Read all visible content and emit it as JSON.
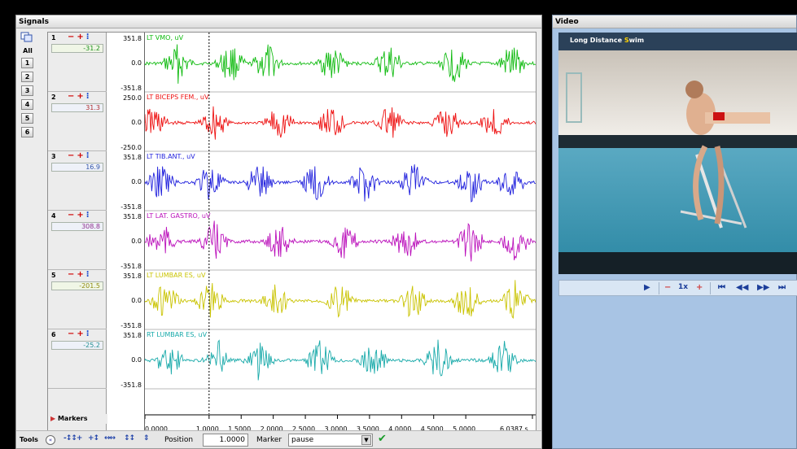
{
  "signals": {
    "title": "Signals",
    "selector_all": "All",
    "channel_buttons": [
      "1",
      "2",
      "3",
      "4",
      "5",
      "6"
    ],
    "channels": [
      {
        "num": "1",
        "value": "-31.2",
        "name": "LT VMO, uV",
        "max": "351.8",
        "zero": "0.0",
        "min": "-351.8",
        "color": "#11bb11",
        "value_color": "#1b8f1b"
      },
      {
        "num": "2",
        "value": "31.3",
        "name": "LT BICEPS FEM., uV",
        "max": "250.0",
        "zero": "0.0",
        "min": "-250.0",
        "color": "#ee1111",
        "value_color": "#b03030"
      },
      {
        "num": "3",
        "value": "16.9",
        "name": "LT TIB.ANT., uV",
        "max": "351.8",
        "zero": "0.0",
        "min": "-351.8",
        "color": "#2222dd",
        "value_color": "#3355aa"
      },
      {
        "num": "4",
        "value": "308.8",
        "name": "LT LAT. GASTRO, uV",
        "max": "351.8",
        "zero": "0.0",
        "min": "-351.8",
        "color": "#bb11bb",
        "value_color": "#903090"
      },
      {
        "num": "5",
        "value": "-201.5",
        "name": "LT LUMBAR ES, uV",
        "max": "351.8",
        "zero": "0.0",
        "min": "-351.8",
        "color": "#c9c300",
        "value_color": "#8f8a10"
      },
      {
        "num": "6",
        "value": "-25.2",
        "name": "RT LUMBAR ES, uV",
        "max": "351.8",
        "zero": "0.0",
        "min": "-351.8",
        "color": "#19aaaa",
        "value_color": "#208f8f"
      }
    ],
    "markers_label": "Markers",
    "time_ticks": [
      "0.0000",
      "1.0000",
      "1.5000",
      "2.0000",
      "2.5000",
      "3.0000",
      "3.5000",
      "4.0000",
      "4.5000",
      "5.0000",
      "6.0387 s"
    ],
    "time_values": [
      0,
      1.0,
      1.5,
      2.0,
      2.5,
      3.0,
      3.5,
      4.0,
      4.5,
      5.0,
      6.0387
    ],
    "time_range": [
      0,
      6.0387
    ],
    "cursor_time": 1.0
  },
  "tools": {
    "label": "Tools",
    "position_label": "Position",
    "position_value": "1.0000",
    "marker_label": "Marker",
    "marker_value": "pause"
  },
  "video": {
    "title": "Video",
    "banner_text_1": "Long Distance ",
    "banner_text_2": "S",
    "banner_text_3": "wim",
    "speed_label": "1x"
  },
  "icons": [
    "copy-channels-icon",
    "minus-icon",
    "plus-icon",
    "channel-menu-icon",
    "markers-expand-icon",
    "tools-toggle-icon",
    "zoom-in-icon",
    "zoom-out-icon",
    "fit-icon",
    "expand-icon",
    "dropdown-icon",
    "check-icon",
    "play-icon",
    "skip-start-icon",
    "step-back-icon",
    "step-forward-icon"
  ]
}
